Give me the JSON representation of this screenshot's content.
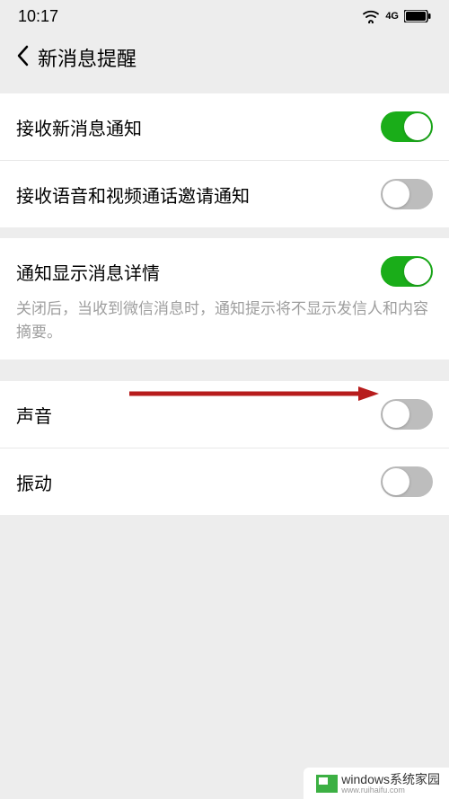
{
  "statusBar": {
    "time": "10:17",
    "signalLabel": "4G"
  },
  "header": {
    "title": "新消息提醒"
  },
  "settings": {
    "receiveNewMessage": {
      "label": "接收新消息通知",
      "enabled": true
    },
    "receiveVoiceVideo": {
      "label": "接收语音和视频通话邀请通知",
      "enabled": false
    },
    "showDetails": {
      "label": "通知显示消息详情",
      "enabled": true,
      "description": "关闭后，当收到微信消息时，通知提示将不显示发信人和内容摘要。"
    },
    "sound": {
      "label": "声音",
      "enabled": false
    },
    "vibrate": {
      "label": "振动",
      "enabled": false
    }
  },
  "watermark": {
    "main": "windows系统家园",
    "sub": "www.ruihaifu.com"
  }
}
